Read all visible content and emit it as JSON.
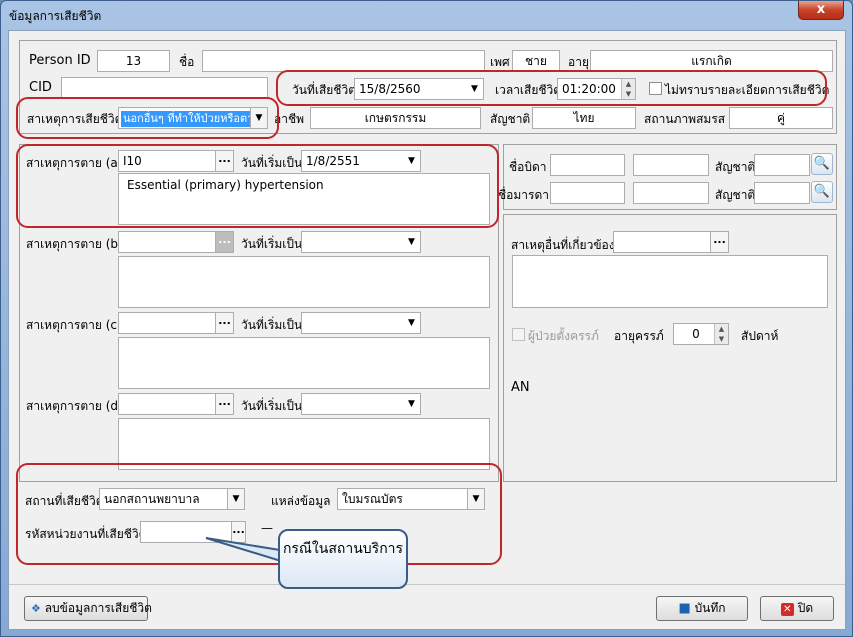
{
  "window": {
    "title": "ข้อมูลการเสียชีวิต",
    "close_label": "x"
  },
  "person": {
    "id_label": "Person ID",
    "id_value": "13",
    "name_label": "ชื่อ",
    "name_value": "",
    "sex_label": "เพศ",
    "sex_value": "ชาย",
    "age_label": "อายุ",
    "age_value": "แรกเกิด",
    "cid_label": "CID",
    "cid_value": ""
  },
  "death": {
    "date_label": "วันที่เสียชีวิต",
    "date_value": "15/8/2560",
    "time_label": "เวลาเสียชีวิต",
    "time_value": "01:20:00",
    "unknown_label": "ไม่ทราบรายละเอียดการเสียชีวิต",
    "cause_label": "สาเหตุการเสียชีวิต",
    "cause_value": "นอกอื่นๆ ที่ทำให้ป่วยหรือตาย",
    "occupation_label": "อาชีพ",
    "occupation_value": "เกษตรกรรม",
    "nationality_label": "สัญชาติ",
    "nationality_value": "ไทย",
    "marital_label": "สถานภาพสมรส",
    "marital_value": "คู่"
  },
  "causes": {
    "a": {
      "label": "สาเหตุการตาย (a)",
      "code": "I10",
      "date_label": "วันที่เริ่มเป็น",
      "date": "1/8/2551",
      "text": "Essential (primary) hypertension"
    },
    "b": {
      "label": "สาเหตุการตาย (b)",
      "code": "",
      "date_label": "วันที่เริ่มเป็น",
      "date": "",
      "text": ""
    },
    "c": {
      "label": "สาเหตุการตาย (c)",
      "code": "",
      "date_label": "วันที่เริ่มเป็น",
      "date": "",
      "text": ""
    },
    "d": {
      "label": "สาเหตุการตาย (d)",
      "code": "",
      "date_label": "วันที่เริ่มเป็น",
      "date": "",
      "text": ""
    }
  },
  "parents": {
    "father_label": "ชื่อบิดา",
    "mother_label": "ชื่อมารดา",
    "nationality_label": "สัญชาติ"
  },
  "other": {
    "related_cause_label": "สาเหตุอื่นที่เกี่ยวข้อง",
    "pregnant_label": "ผู้ป่วยตั้งครรภ์",
    "ga_label": "อายุครรภ์",
    "ga_value": "0",
    "week_label": "สัปดาห์",
    "an_label": "AN"
  },
  "place": {
    "place_label": "สถานที่เสียชีวิต",
    "place_value": "นอกสถานพยาบาล",
    "source_label": "แหล่งข้อมูล",
    "source_value": "ใบมรณบัตร",
    "unit_label": "รหัสหน่วยงานที่เสียชีวิต",
    "unit_value": "",
    "dash": "—"
  },
  "callout": {
    "text": "กรณีในสถานบริการ"
  },
  "footer": {
    "delete_label": "ลบข้อมูลการเสียชีวิต",
    "save_label": "บันทึก",
    "close_label": "ปิด"
  },
  "icons": {
    "dots": "...",
    "dropdown": "▼",
    "spin_up": "▲",
    "spin_down": "▼",
    "search": "🔍"
  }
}
